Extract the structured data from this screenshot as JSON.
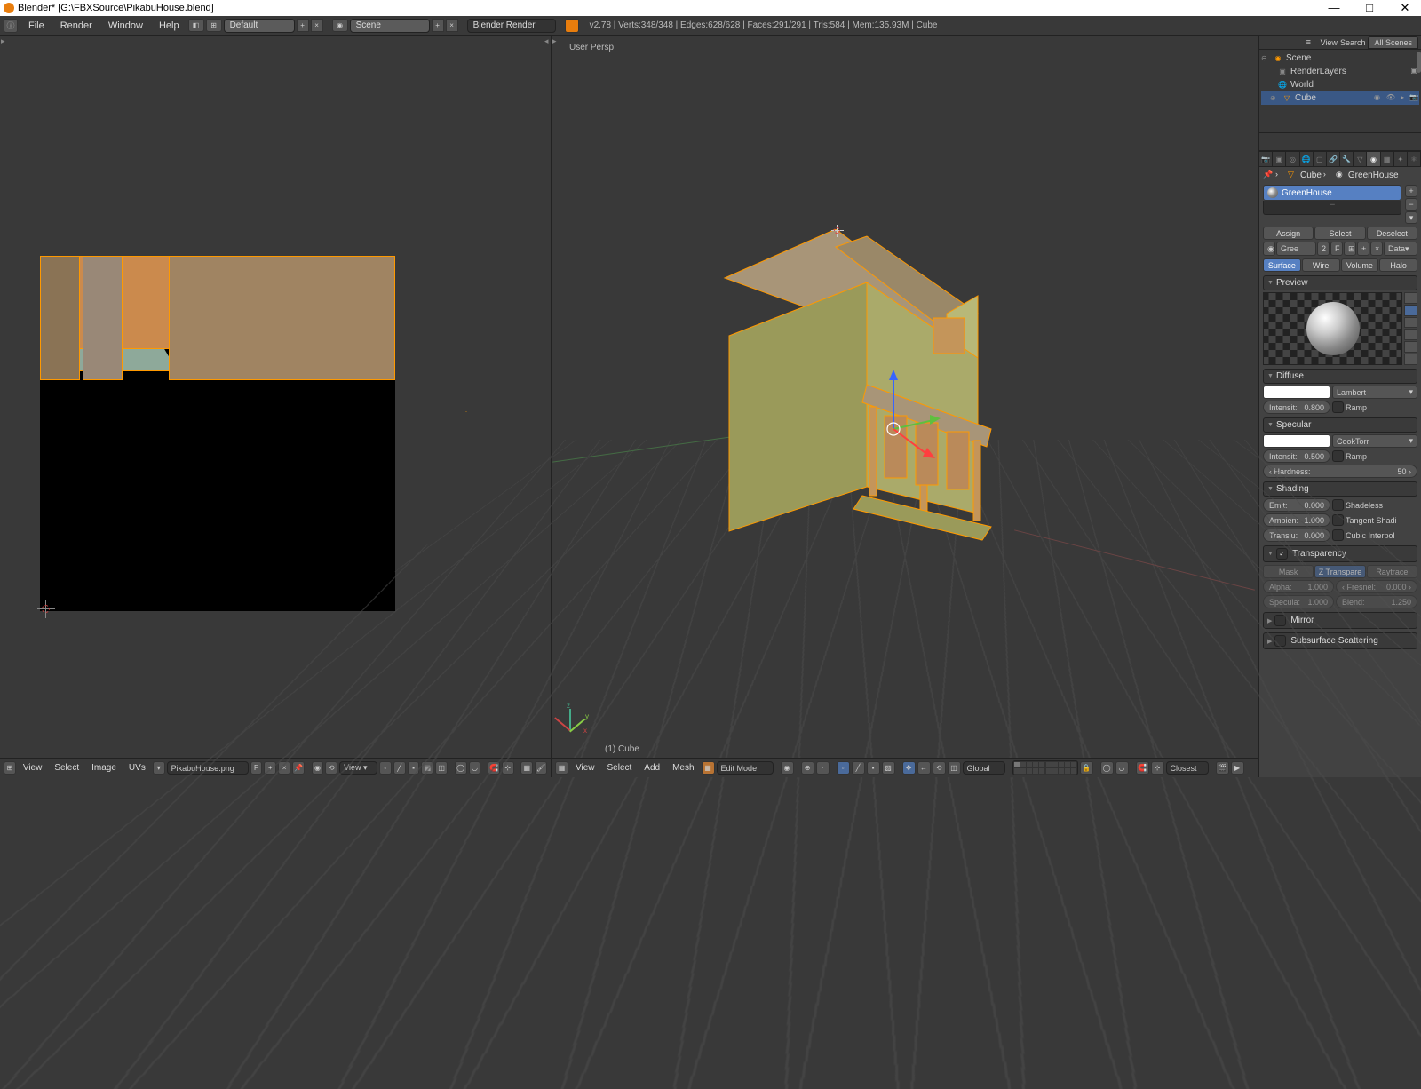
{
  "titlebar": {
    "title": "Blender* [G:\\FBXSource\\PikabuHouse.blend]"
  },
  "topmenu": {
    "file": "File",
    "render": "Render",
    "window": "Window",
    "help": "Help",
    "layout": "Default",
    "scene": "Scene",
    "engine": "Blender Render",
    "stats": "v2.78 | Verts:348/348 | Edges:628/628 | Faces:291/291 | Tris:584 | Mem:135.93M | Cube"
  },
  "outliner": {
    "header": {
      "view": "View",
      "search": "Search",
      "mode": "All Scenes"
    },
    "tree": {
      "scene": "Scene",
      "renderlayers": "RenderLayers",
      "world": "World",
      "cube": "Cube"
    }
  },
  "viewport3d": {
    "label": "User Persp",
    "object_label": "(1) Cube"
  },
  "uvfooter": {
    "view": "View",
    "select": "Select",
    "image": "Image",
    "uvs": "UVs",
    "imgname": "PikabuHouse.png",
    "pin": "F"
  },
  "v3dfooter": {
    "view": "View",
    "select": "Select",
    "add": "Add",
    "mesh": "Mesh",
    "mode": "Edit Mode",
    "orientation": "Global",
    "snap": "Closest"
  },
  "props": {
    "breadcrumb": {
      "obj": "Cube",
      "mat": "GreenHouse"
    },
    "material_name": "GreenHouse",
    "assign": "Assign",
    "select": "Select",
    "deselect": "Deselect",
    "short": "Gree",
    "users": "2",
    "fake": "F",
    "data": "Data",
    "tabs": {
      "surface": "Surface",
      "wire": "Wire",
      "volume": "Volume",
      "halo": "Halo"
    },
    "preview": "Preview",
    "diffuse": {
      "title": "Diffuse",
      "model": "Lambert",
      "intensity_label": "Intensit:",
      "intensity": "0.800",
      "ramp": "Ramp"
    },
    "specular": {
      "title": "Specular",
      "model": "CookTorr",
      "intensity_label": "Intensit:",
      "intensity": "0.500",
      "ramp": "Ramp",
      "hardness_label": "Hardness:",
      "hardness": "50"
    },
    "shading": {
      "title": "Shading",
      "emit_label": "Emit:",
      "emit": "0.000",
      "ambient_label": "Ambien:",
      "ambient": "1.000",
      "translu_label": "Translu:",
      "translu": "0.000",
      "shadeless": "Shadeless",
      "tangent": "Tangent Shadi",
      "cubic": "Cubic Interpol"
    },
    "transparency": {
      "title": "Transparency",
      "mask": "Mask",
      "ztrans": "Z Transpare",
      "raytrace": "Raytrace",
      "alpha_label": "Alpha:",
      "alpha": "1.000",
      "fresnel_label": "Fresnel:",
      "fresnel": "0.000",
      "specular_label": "Specula:",
      "specular": "1.000",
      "blend_label": "Blend:",
      "blend": "1.250"
    },
    "mirror": "Mirror",
    "sss": "Subsurface Scattering"
  }
}
